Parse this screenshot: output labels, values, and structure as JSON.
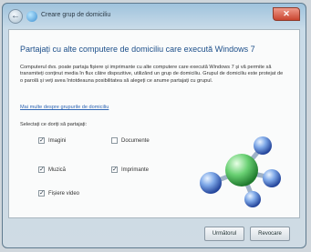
{
  "window": {
    "title": "Creare grup de domiciliu"
  },
  "content": {
    "heading": "Partajați cu alte computere de domiciliu care execută Windows 7",
    "description": "Computerul dvs. poate partaja fișiere și imprimante cu alte computere care execută Windows 7 și vă permite să transmiteți conținut media în flux către dispozitive, utilizând un grup de domiciliu. Grupul de domiciliu este protejat de o parolă și veți avea întotdeauna posibilitatea să alegeți ce anume partajați cu grupul.",
    "link": "Mai multe despre grupurile de domiciliu",
    "select_label": "Selectați ce doriți să partajați:",
    "options": [
      {
        "label": "Imagini",
        "checked": true
      },
      {
        "label": "Documente",
        "checked": false
      },
      {
        "label": "Muzică",
        "checked": true
      },
      {
        "label": "Imprimante",
        "checked": true
      },
      {
        "label": "Fișiere video",
        "checked": true
      }
    ]
  },
  "buttons": {
    "next": "Următorul",
    "cancel": "Revocare"
  },
  "icons": {
    "back": "back-arrow-icon",
    "homegroup": "homegroup-icon",
    "close": "close-icon",
    "check": "checkmark-icon"
  },
  "colors": {
    "heading": "#1d4f8a",
    "link": "#2f66b4",
    "close_button": "#c9452f"
  }
}
